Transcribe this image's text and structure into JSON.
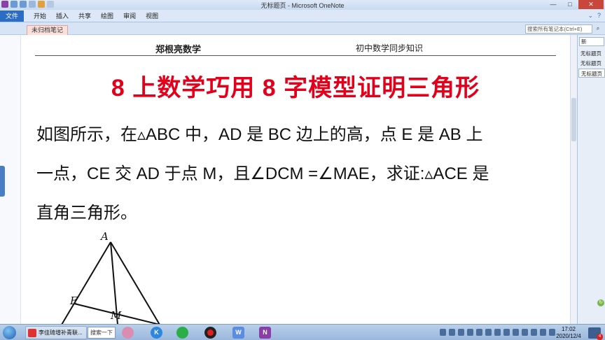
{
  "window": {
    "title": "无标题页 - Microsoft OneNote",
    "controls": [
      "—",
      "□",
      "✕"
    ]
  },
  "ribbon": {
    "file_tab": "文件",
    "tabs": [
      "开始",
      "插入",
      "共享",
      "绘图",
      "审阅",
      "视图"
    ]
  },
  "section": {
    "tab_label": "未归档笔记",
    "search_placeholder": "搜索所有笔记本(Ctrl+E)"
  },
  "page": {
    "header_left": "郑根亮数学",
    "header_right": "初中数学同步知识",
    "title": "8 上数学巧用 8 字模型证明三角形",
    "problem_lines": [
      "如图所示，在▵ABC 中，AD 是  BC 边上的高，点 E 是 AB 上",
      "一点，CE 交 AD 于点 M，且∠DCM =∠MAE，求证:▵ACE 是",
      "直角三角形。"
    ],
    "figure_labels": {
      "a": "A",
      "e": "E",
      "m": "M"
    }
  },
  "pages_panel": {
    "new_page": "新",
    "items": [
      "无标题页",
      "无标题页",
      "无标题页"
    ]
  },
  "taskbar": {
    "active_app": "李佳琦增补青联...",
    "search_label": "搜索一下",
    "clock_time": "17:02",
    "clock_date": "2020/12/4",
    "notification_count": "4"
  },
  "colors": {
    "title_red": "#e3001a",
    "file_tab_blue": "#2b6cc4"
  }
}
